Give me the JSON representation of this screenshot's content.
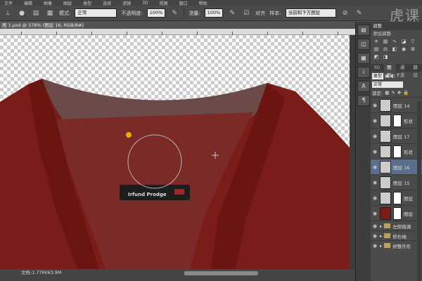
{
  "menubar": {
    "items": [
      "文件",
      "编辑",
      "图像",
      "图层",
      "类型",
      "选择",
      "滤镜",
      "3D",
      "视图",
      "窗口",
      "帮助"
    ]
  },
  "options": {
    "mode_label": "模式:",
    "mode_value": "正常",
    "opacity_label": "不透明度:",
    "opacity_value": "100%",
    "flow_label": "流量:",
    "flow_value": "100%",
    "align_label": "对齐",
    "sample_label": "样本:",
    "sample_value": "当前和下方图层"
  },
  "watermark": "虎课",
  "document": {
    "tab_title": "图 1.psd @ 378% (图层 16, RGB/8#) *",
    "status": "文档:1.77M/63.9M"
  },
  "canvas": {
    "label_text": "Irfund Prodge"
  },
  "adjustments": {
    "title": "调整",
    "subtitle": "添加调整"
  },
  "layers": {
    "tabs": [
      "3D",
      "图层",
      "通道",
      "路径"
    ],
    "active_tab": "图层",
    "filter_label": "类型",
    "blend_mode": "正常",
    "lock_label": "锁定:",
    "items": [
      {
        "name": "图层 14",
        "mask": false,
        "selected": false
      },
      {
        "name": "形状",
        "mask": true,
        "selected": false
      },
      {
        "name": "图层 17",
        "mask": false,
        "selected": false
      },
      {
        "name": "形状",
        "mask": true,
        "selected": false
      },
      {
        "name": "图层 16",
        "mask": false,
        "selected": true
      },
      {
        "name": "图层 15",
        "mask": false,
        "selected": false
      },
      {
        "name": "图层",
        "mask": true,
        "selected": false
      },
      {
        "name": "图层",
        "mask": true,
        "selected": false
      }
    ],
    "groups": [
      "左侧微调",
      "修右袖",
      "修整外形"
    ]
  }
}
